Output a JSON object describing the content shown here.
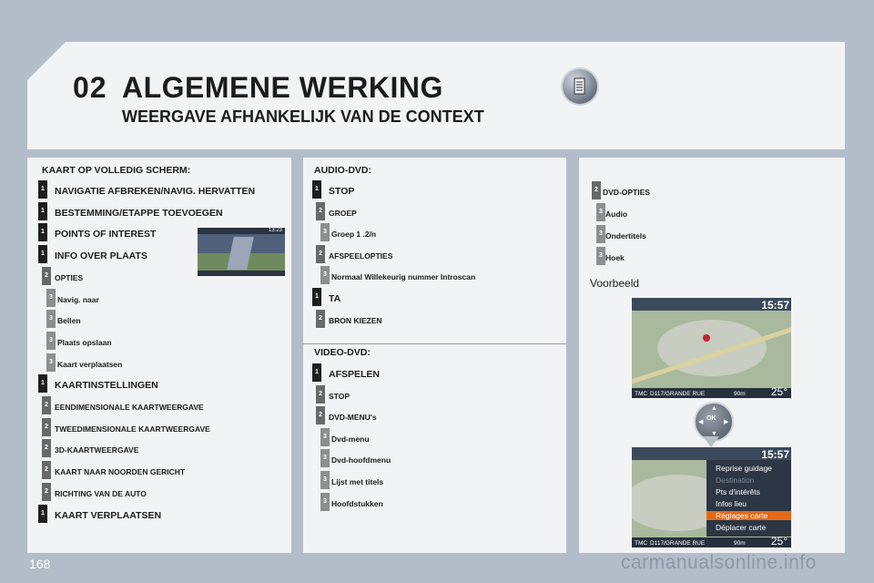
{
  "header": {
    "chapter": "02",
    "title": "ALGEMENE WERKING",
    "subtitle": "WEERGAVE AFHANKELIJK VAN DE CONTEXT",
    "icon": "document-icon"
  },
  "col1": {
    "heading": "KAART OP VOLLEDIG SCHERM:",
    "items": [
      {
        "level": "1",
        "label": "NAVIGATIE AFBREKEN/NAVIG. HERVATTEN"
      },
      {
        "level": "1",
        "label": "BESTEMMING/ETAPPE TOEVOEGEN"
      },
      {
        "level": "1",
        "label": "POINTS OF INTEREST"
      },
      {
        "level": "1",
        "label": "INFO OVER PLAATS"
      },
      {
        "level": "2",
        "label": "OPTIES"
      },
      {
        "level": "3",
        "label": "Navig. naar"
      },
      {
        "level": "3",
        "label": "Bellen"
      },
      {
        "level": "3",
        "label": "Plaats opslaan"
      },
      {
        "level": "3",
        "label": "Kaart verplaatsen"
      },
      {
        "level": "1",
        "label": "KAARTINSTELLINGEN"
      },
      {
        "level": "2",
        "label": "EENDIMENSIONALE KAARTWEERGAVE"
      },
      {
        "level": "2",
        "label": "TWEEDIMENSIONALE KAARTWEERGAVE"
      },
      {
        "level": "2",
        "label": "3D-KAARTWEERGAVE"
      },
      {
        "level": "2",
        "label": "KAART NAAR NOORDEN GERICHT"
      },
      {
        "level": "2",
        "label": "RICHTING VAN DE AUTO"
      },
      {
        "level": "1",
        "label": "KAART VERPLAATSEN"
      }
    ],
    "thumb_time": "13:23"
  },
  "col2": {
    "heading_audio": "AUDIO-DVD:",
    "audio_items": [
      {
        "level": "1",
        "label": "STOP"
      },
      {
        "level": "2",
        "label": "GROEP"
      },
      {
        "level": "3",
        "label": "Groep 1 .2/n"
      },
      {
        "level": "2",
        "label": "AFSPEELOPTIES"
      },
      {
        "level": "3",
        "label": "Normaal Willekeurig nummer Introscan"
      },
      {
        "level": "1",
        "label": "TA"
      },
      {
        "level": "2",
        "label": "BRON KIEZEN"
      }
    ],
    "heading_video": "VIDEO-DVD:",
    "video_items": [
      {
        "level": "1",
        "label": "AFSPELEN"
      },
      {
        "level": "2",
        "label": "STOP"
      },
      {
        "level": "2",
        "label": "DVD-MENU's"
      },
      {
        "level": "3",
        "label": "Dvd-menu"
      },
      {
        "level": "3",
        "label": "Dvd-hoofdmenu"
      },
      {
        "level": "3",
        "label": "Lijst met titels"
      },
      {
        "level": "3",
        "label": "Hoofdstukken"
      }
    ]
  },
  "col3": {
    "items": [
      {
        "level": "2",
        "label": "DVD-OPTIES"
      },
      {
        "level": "3",
        "label": "Audio"
      },
      {
        "level": "3",
        "label": "Ondertitels"
      },
      {
        "level": "3",
        "label": "Hoek"
      }
    ],
    "example_label": "Voorbeeld",
    "map1": {
      "time": "15:57",
      "street": "D117/GRANDE RUE",
      "tmc": "TMC",
      "distance": "90m",
      "temp": "25°"
    },
    "map2": {
      "time": "15:57",
      "street": "D117/GRANDE RUE",
      "tmc": "TMC",
      "distance": "90m",
      "temp": "25°",
      "menu": [
        "Reprise guidage",
        "Destination",
        "Pts d'intérêts",
        "Infos lieu",
        "Réglages carte",
        "Déplacer carte"
      ],
      "selected_index": 4,
      "dim_index": 1
    },
    "joystick_label": "OK"
  },
  "footer": {
    "page_number": "168",
    "watermark": "carmanualsonline.info"
  }
}
